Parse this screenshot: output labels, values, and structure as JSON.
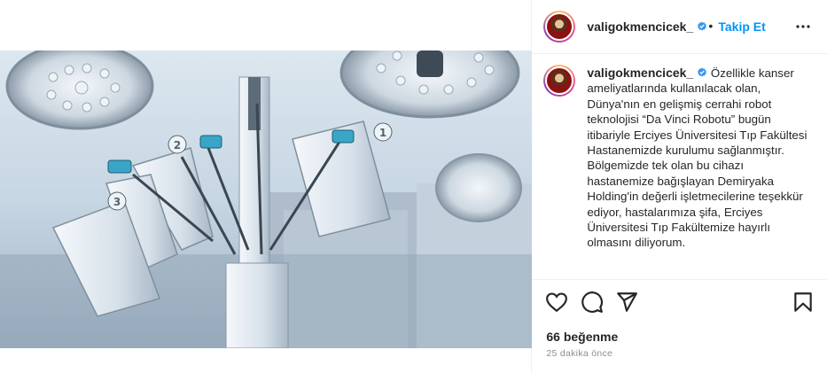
{
  "post": {
    "image_alt": "Da Vinci surgical robot arms in operating room",
    "robot_arm_numbers": [
      "2",
      "1",
      "3"
    ]
  },
  "header": {
    "username": "valigokmencicek_",
    "separator": "•",
    "follow_label": "Takip Et"
  },
  "caption": {
    "username": "valigokmencicek_",
    "text": "Özellikle kanser ameliyatlarında kullanılacak olan, Dünya'nın en gelişmiş cerrahi robot teknolojisi “Da Vinci Robotu” bugün itibariyle Erciyes Üniversitesi Tıp Fakültesi Hastanemizde kurulumu sağlanmıştır. Bölgemizde tek olan bu cihazı hastanemize bağışlayan Demiryaka Holding'in değerli işletmecilerine teşekkür ediyor, hastalarımıza şifa, Erciyes Üniversitesi Tıp Fakültemize hayırlı olmasını diliyorum."
  },
  "actions": {
    "like_icon": "heart-icon",
    "comment_icon": "comment-icon",
    "share_icon": "send-icon",
    "save_icon": "bookmark-icon"
  },
  "likes": "66 beğenme",
  "timestamp": "25 dakika önce",
  "colors": {
    "accent": "#0095f6",
    "verified": "#3897f0",
    "text": "#262626",
    "muted": "#8e8e8e",
    "border": "#efefef"
  }
}
